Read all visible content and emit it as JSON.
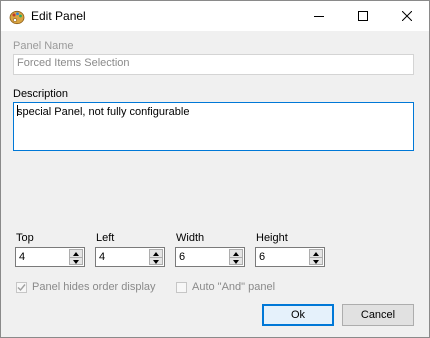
{
  "window": {
    "title": "Edit Panel"
  },
  "panel_name": {
    "label": "Panel Name",
    "value": "Forced Items Selection"
  },
  "description": {
    "label": "Description",
    "value": "special Panel, not fully configurable"
  },
  "fields": [
    {
      "label": "Top",
      "value": "4"
    },
    {
      "label": "Left",
      "value": "4"
    },
    {
      "label": "Width",
      "value": "6"
    },
    {
      "label": "Height",
      "value": "6"
    }
  ],
  "options": {
    "hides_order_display": {
      "label": "Panel hides order display",
      "checked": true
    },
    "auto_and": {
      "label": "Auto \"And\" panel",
      "checked": false
    }
  },
  "buttons": {
    "ok": "Ok",
    "cancel": "Cancel"
  },
  "colors": {
    "accent": "#0078d7",
    "disabled_text": "#8a8a8a",
    "dialog_bg": "#f0f0f0"
  }
}
